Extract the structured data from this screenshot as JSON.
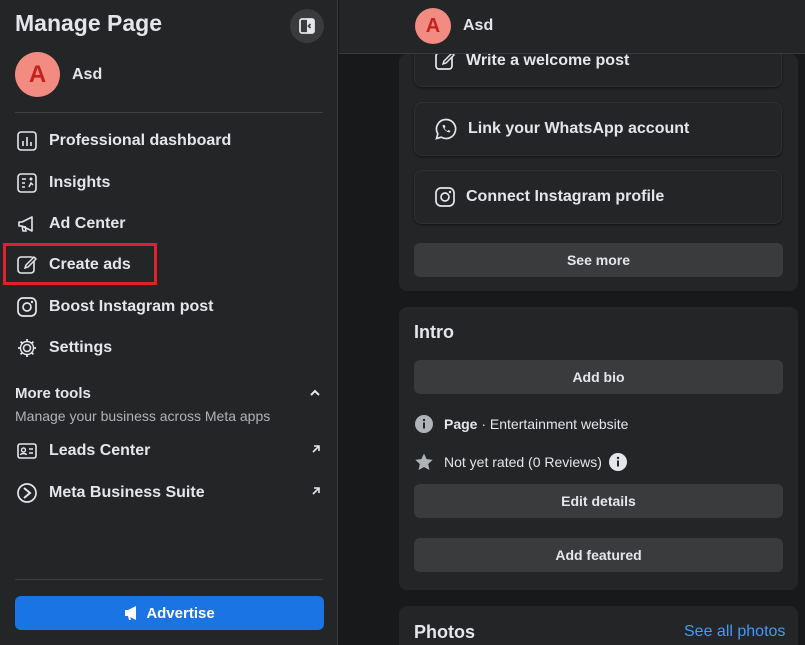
{
  "sidebar": {
    "title": "Manage Page",
    "page": {
      "initial": "A",
      "name": "Asd"
    },
    "items": [
      {
        "label": "Professional dashboard",
        "icon": "dashboard-icon"
      },
      {
        "label": "Insights",
        "icon": "insights-icon"
      },
      {
        "label": "Ad Center",
        "icon": "megaphone-icon"
      },
      {
        "label": "Create ads",
        "icon": "pencil-icon"
      },
      {
        "label": "Boost Instagram post",
        "icon": "instagram-icon"
      },
      {
        "label": "Settings",
        "icon": "gear-icon"
      }
    ],
    "more_tools": {
      "title": "More tools",
      "subtitle": "Manage your business across Meta apps",
      "items": [
        {
          "label": "Leads Center",
          "icon": "contact-card-icon"
        },
        {
          "label": "Meta Business Suite",
          "icon": "meta-business-suite-icon"
        }
      ]
    },
    "advertise_label": "Advertise"
  },
  "topbar": {
    "initial": "A",
    "name": "Asd"
  },
  "setup": {
    "actions": [
      {
        "label": "Write a welcome post",
        "icon": "compose-icon"
      },
      {
        "label": "Link your WhatsApp account",
        "icon": "whatsapp-icon"
      },
      {
        "label": "Connect Instagram profile",
        "icon": "instagram-icon"
      }
    ],
    "see_more": "See more"
  },
  "intro": {
    "title": "Intro",
    "add_bio": "Add bio",
    "category_label": "Page",
    "category_value": " · Entertainment website",
    "rating": "Not yet rated (0 Reviews)",
    "edit_details": "Edit details",
    "add_featured": "Add featured"
  },
  "photos": {
    "title": "Photos",
    "see_all": "See all photos"
  },
  "colors": {
    "accent": "#1b74e4",
    "highlight": "#e0202c",
    "link": "#4599ff"
  }
}
